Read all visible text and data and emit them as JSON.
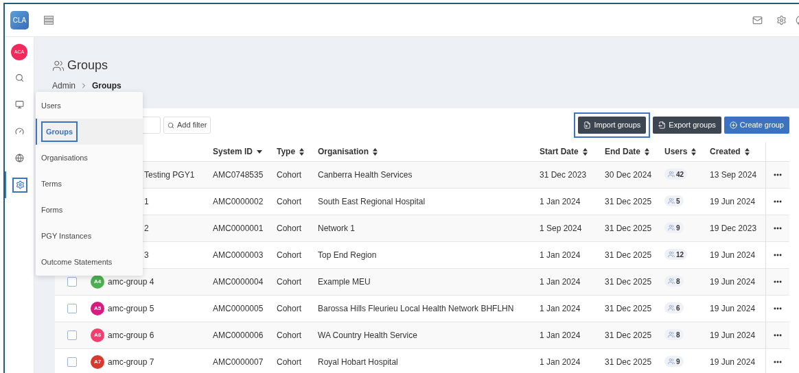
{
  "logo": {
    "text": "CLA"
  },
  "user_avatar": {
    "initials": "ACA",
    "color": "#f2295b"
  },
  "sidebar": {
    "items": [
      {
        "selected": false,
        "highlighted": false
      },
      {
        "selected": false,
        "highlighted": false
      },
      {
        "selected": false,
        "highlighted": false
      },
      {
        "selected": false,
        "highlighted": false
      },
      {
        "selected": true,
        "highlighted": true
      }
    ]
  },
  "page": {
    "title": "Groups",
    "breadcrumb": [
      {
        "label": "Admin",
        "current": false
      },
      {
        "label": "Groups",
        "current": true
      }
    ]
  },
  "menu": {
    "items": [
      {
        "label": "Users",
        "selected": false,
        "highlighted": false
      },
      {
        "label": "Groups",
        "selected": true,
        "highlighted": true
      },
      {
        "label": "Organisations",
        "selected": false,
        "highlighted": false
      },
      {
        "label": "Terms",
        "selected": false,
        "highlighted": false
      },
      {
        "label": "Forms",
        "selected": false,
        "highlighted": false
      },
      {
        "label": "PGY Instances",
        "selected": false,
        "highlighted": false
      },
      {
        "label": "Outcome Statements",
        "selected": false,
        "highlighted": false
      }
    ]
  },
  "toolbar": {
    "add_filter": "Add filter",
    "buttons": [
      {
        "label": "Import groups",
        "kind": "import",
        "highlighted": true
      },
      {
        "label": "Export groups",
        "kind": "export",
        "highlighted": false
      },
      {
        "label": "Create group",
        "kind": "create",
        "highlighted": false
      }
    ]
  },
  "table": {
    "columns": [
      {
        "label": "System ID",
        "sorted": true
      },
      {
        "label": "Type",
        "sorted": false
      },
      {
        "label": "Organisation",
        "sorted": false
      },
      {
        "label": "Start Date",
        "sorted": false
      },
      {
        "label": "End Date",
        "sorted": false
      },
      {
        "label": "Users",
        "sorted": false
      },
      {
        "label": "Created",
        "sorted": false
      }
    ],
    "rows": [
      {
        "name": "Testing PGY1",
        "system_id": "AMC0748535",
        "type": "Cohort",
        "organisation": "Canberra Health Services",
        "start": "31 Dec 2023",
        "end": "30 Dec 2024",
        "users": "42",
        "created": "13 Sep 2024"
      },
      {
        "name": "1",
        "system_id": "AMC0000002",
        "type": "Cohort",
        "organisation": "South East Regional Hospital",
        "start": "1 Jan 2024",
        "end": "31 Dec 2025",
        "users": "5",
        "created": "19 Jun 2024"
      },
      {
        "name": "2",
        "system_id": "AMC0000001",
        "type": "Cohort",
        "organisation": "Network 1",
        "start": "1 Sep 2024",
        "end": "31 Dec 2025",
        "users": "9",
        "created": "19 Dec 2023"
      },
      {
        "name": "3",
        "system_id": "AMC0000003",
        "type": "Cohort",
        "organisation": "Top End Region",
        "start": "1 Jan 2024",
        "end": "31 Dec 2025",
        "users": "12",
        "created": "19 Jun 2024"
      },
      {
        "checked": false,
        "avatar": {
          "initials": "A4",
          "color": "#4caf50"
        },
        "name": "amc-group 4",
        "system_id": "AMC0000004",
        "type": "Cohort",
        "organisation": "Example MEU",
        "start": "1 Jan 2024",
        "end": "31 Dec 2025",
        "users": "8",
        "created": "19 Jun 2024"
      },
      {
        "checked": false,
        "avatar": {
          "initials": "A5",
          "color": "#d81b7f"
        },
        "name": "amc-group 5",
        "system_id": "AMC0000005",
        "type": "Cohort",
        "organisation": "Barossa Hills Fleurieu Local Health Network BHFLHN",
        "start": "1 Jan 2024",
        "end": "31 Dec 2025",
        "users": "6",
        "created": "19 Jun 2024"
      },
      {
        "checked": false,
        "avatar": {
          "initials": "A6",
          "color": "#f43f6e"
        },
        "name": "amc-group 6",
        "system_id": "AMC0000006",
        "type": "Cohort",
        "organisation": "WA Country Health Service",
        "start": "1 Jan 2024",
        "end": "31 Dec 2025",
        "users": "8",
        "created": "19 Jun 2024"
      },
      {
        "checked": false,
        "avatar": {
          "initials": "A7",
          "color": "#d63a2f"
        },
        "name": "amc-group 7",
        "system_id": "AMC0000007",
        "type": "Cohort",
        "organisation": "Royal Hobart Hospital",
        "start": "1 Jan 2024",
        "end": "31 Dec 2025",
        "users": "9",
        "created": "19 Jun 2024"
      }
    ]
  }
}
